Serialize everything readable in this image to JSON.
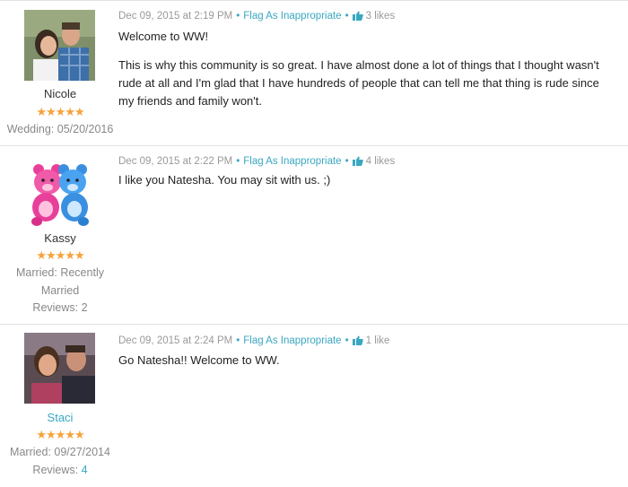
{
  "posts": [
    {
      "user": {
        "name": "Nicole",
        "stars": "★★★★★",
        "meta1": "Wedding: 05/20/2016"
      },
      "date": "Dec 09, 2015 at 2:19 PM",
      "flag": "Flag As Inappropriate",
      "likes": "3 likes",
      "paragraphs": [
        "Welcome to WW!",
        "This is why this community is so great. I have almost done a lot of things that I thought wasn't rude at all and I'm glad that I have hundreds of people that can tell me that thing is rude since my friends and family won't."
      ]
    },
    {
      "user": {
        "name": "Kassy",
        "stars": "★★★★★",
        "meta1": "Married: Recently",
        "meta2": "Married",
        "reviews_label": "Reviews:",
        "reviews_count": "2"
      },
      "date": "Dec 09, 2015 at 2:22 PM",
      "flag": "Flag As Inappropriate",
      "likes": "4 likes",
      "paragraphs": [
        "I like you Natesha. You may sit with us. ;)"
      ]
    },
    {
      "user": {
        "name": "Staci",
        "stars": "★★★★★",
        "meta1": "Married: 09/27/2014",
        "reviews_label": "Reviews:",
        "reviews_count": "4"
      },
      "date": "Dec 09, 2015 at 2:24 PM",
      "flag": "Flag As Inappropriate",
      "likes": "1 like",
      "paragraphs": [
        "Go Natesha!! Welcome to WW."
      ]
    }
  ],
  "colors": {
    "link": "#3aa7c2",
    "star": "#f5a23a",
    "meta": "#888888"
  }
}
